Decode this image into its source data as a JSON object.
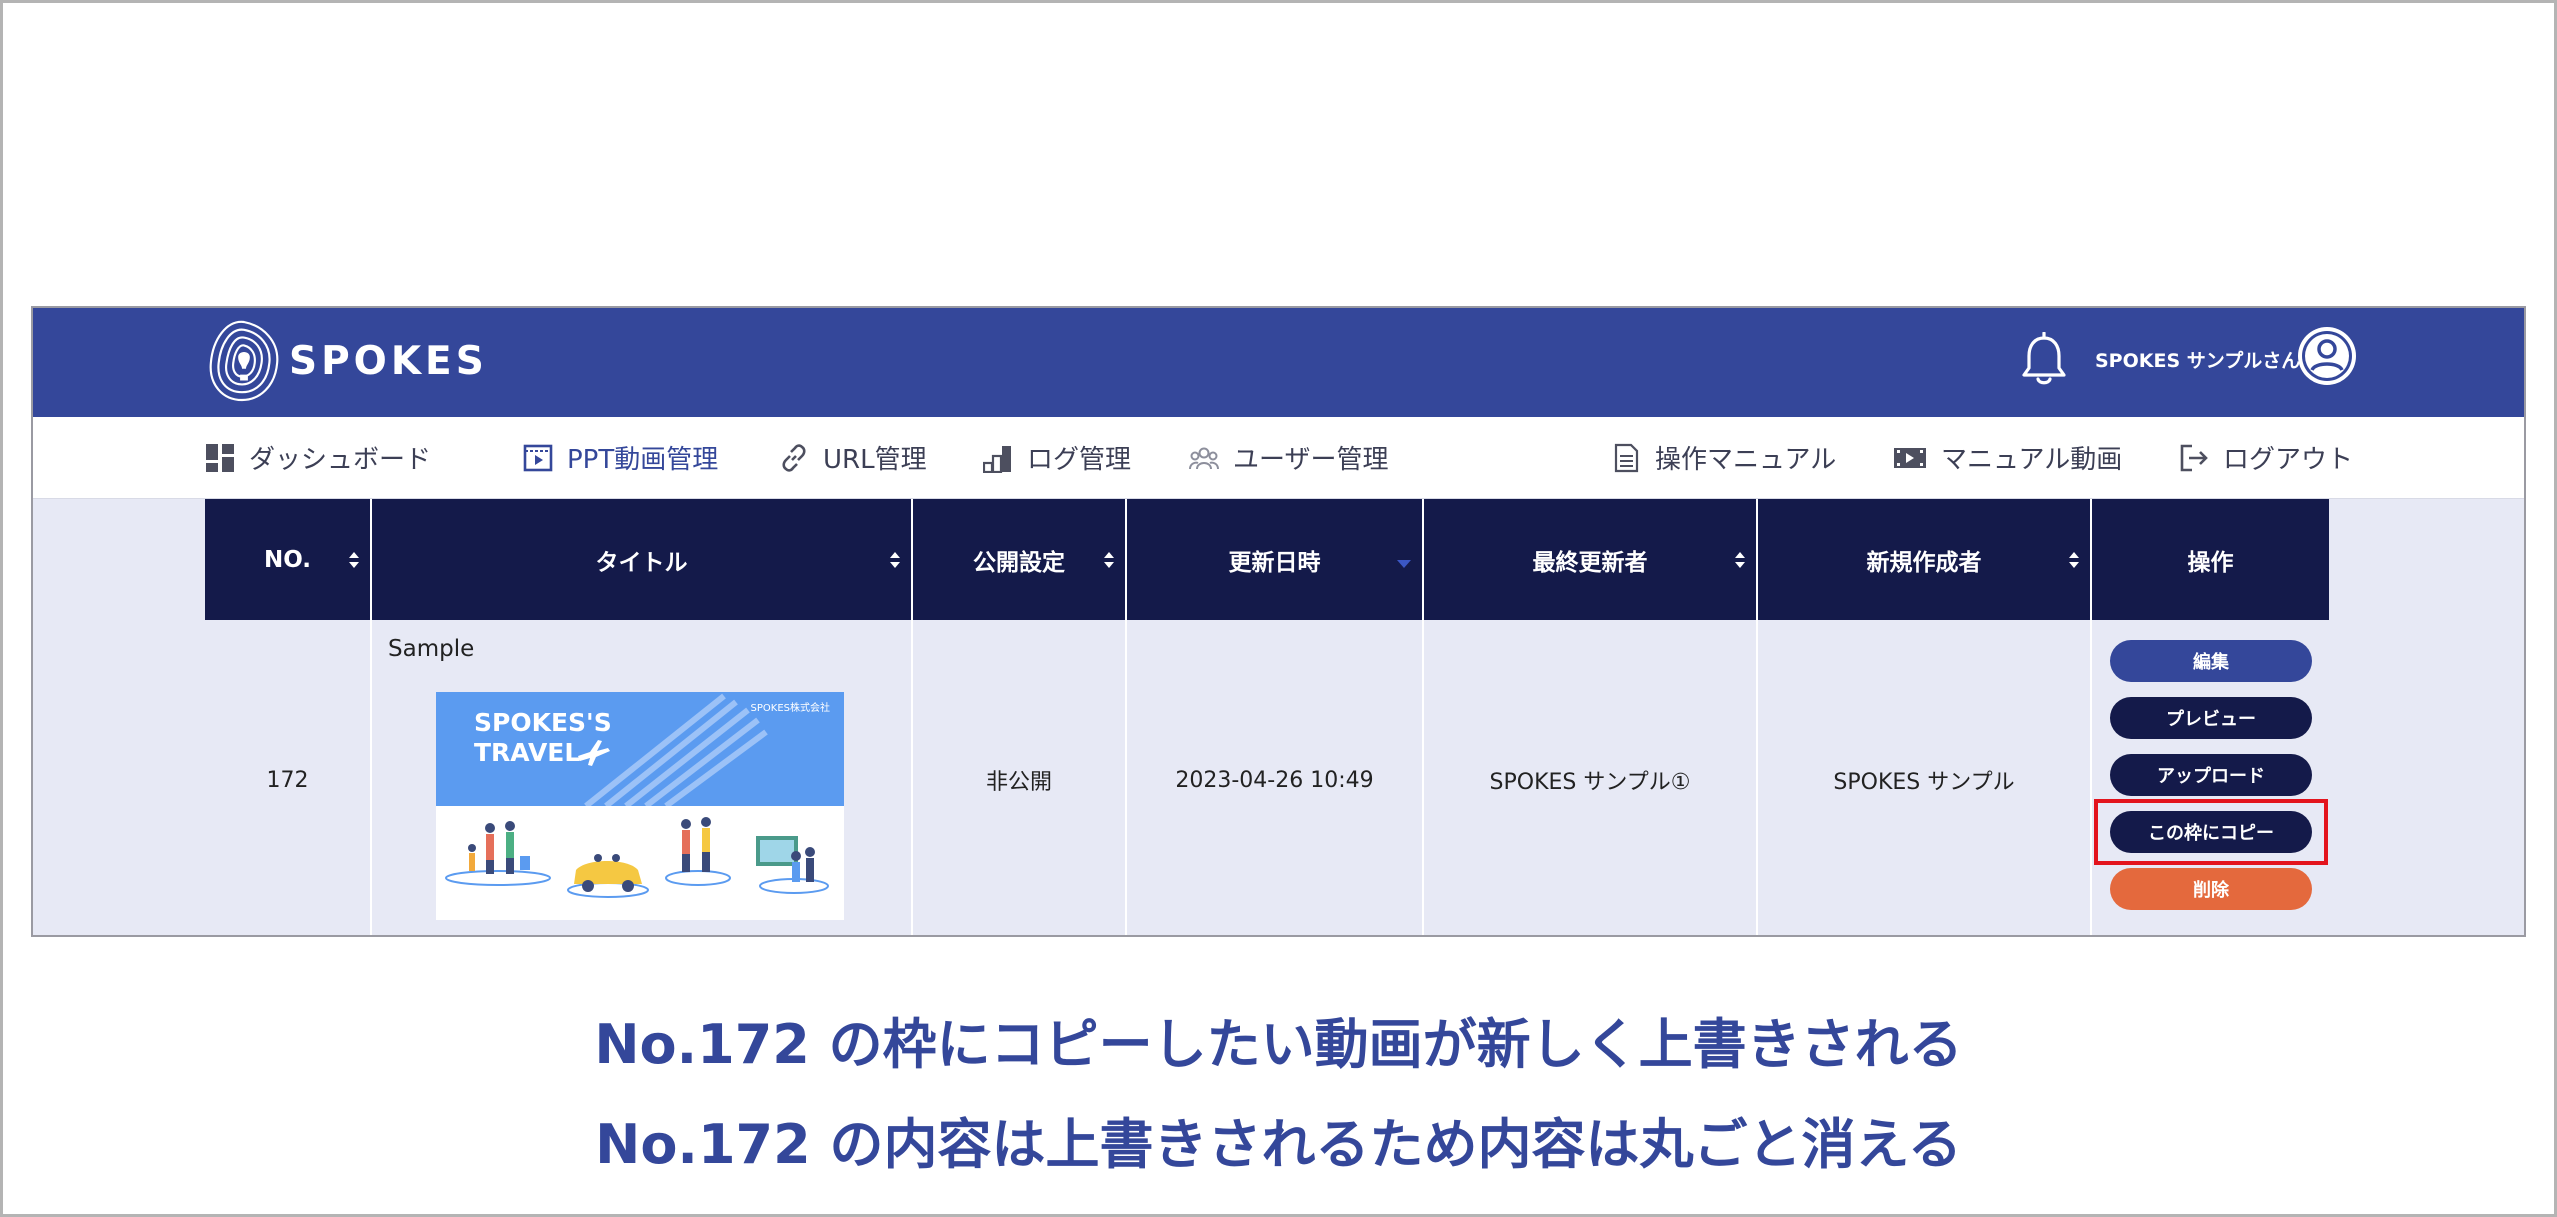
{
  "brand": {
    "name": "SPOKES"
  },
  "header": {
    "user_name": "SPOKES サンプルさん"
  },
  "nav": {
    "left": [
      {
        "label": "ダッシュボード",
        "icon": "dashboard-icon"
      },
      {
        "label": "PPT動画管理",
        "icon": "video-icon"
      },
      {
        "label": "URL管理",
        "icon": "link-icon"
      },
      {
        "label": "ログ管理",
        "icon": "chart-icon"
      },
      {
        "label": "ユーザー管理",
        "icon": "users-icon"
      }
    ],
    "right": [
      {
        "label": "操作マニュアル",
        "icon": "document-icon"
      },
      {
        "label": "マニュアル動画",
        "icon": "film-icon"
      },
      {
        "label": "ログアウト",
        "icon": "logout-icon"
      }
    ]
  },
  "table": {
    "columns": [
      "NO.",
      "タイトル",
      "公開設定",
      "更新日時",
      "最終更新者",
      "新規作成者",
      "操作"
    ],
    "row": {
      "no": "172",
      "title": "Sample",
      "thumbnail": {
        "heading": "SPOKES'S\nTRAVEL",
        "company": "SPOKES株式会社"
      },
      "visibility": "非公開",
      "updated_at": "2023-04-26 10:49",
      "last_editor": "SPOKES サンプル①",
      "creator": "SPOKES サンプル"
    },
    "actions": [
      {
        "label": "編集",
        "color": "#34479a"
      },
      {
        "label": "プレビュー",
        "color": "#141a4a"
      },
      {
        "label": "アップロード",
        "color": "#141a4a"
      },
      {
        "label": "この枠にコピー",
        "color": "#141a4a",
        "highlighted": true
      },
      {
        "label": "削除",
        "color": "#e4693d"
      }
    ]
  },
  "captions": [
    "No.172 の枠にコピーしたい動画が新しく上書きされる",
    "No.172 の内容は上書きされるため内容は丸ごと消える"
  ],
  "colors": {
    "header_bg": "#34479a",
    "table_header_bg": "#141a4a",
    "row_bg": "#e7e9f5",
    "caption": "#34479a",
    "highlight": "#e3141d",
    "delete": "#e4693d"
  }
}
